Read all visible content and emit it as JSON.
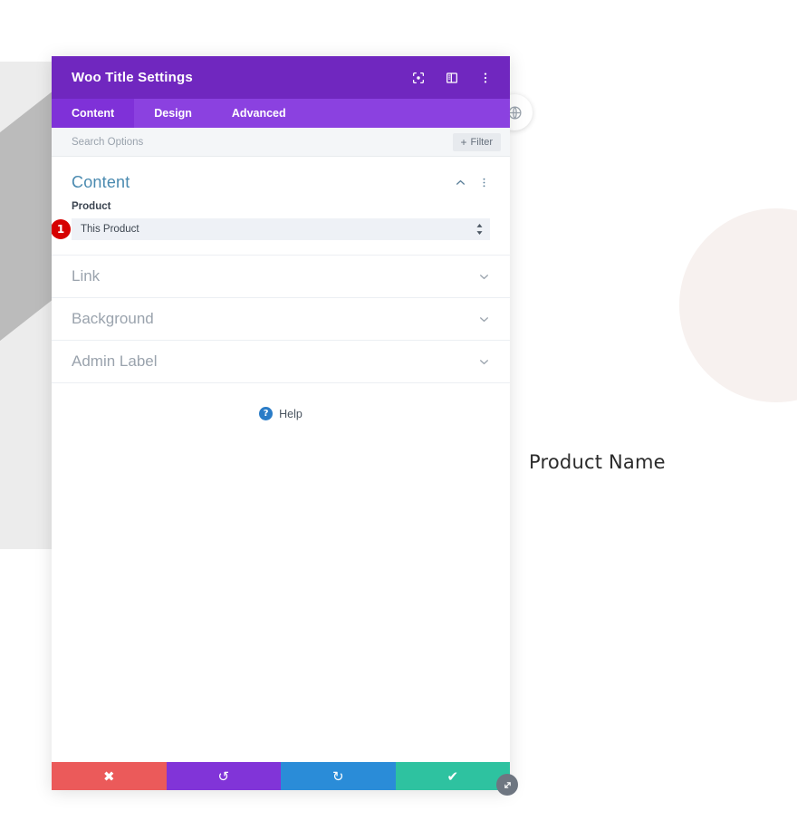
{
  "page": {
    "background_product_title": "Product Name",
    "floating_button_icon": "globe-icon"
  },
  "modal": {
    "title": "Woo Title Settings",
    "titlebar_icons": [
      {
        "name": "focus-target-icon",
        "label": "Focus"
      },
      {
        "name": "layout-panel-icon",
        "label": "Panel Layout"
      },
      {
        "name": "more-vertical-icon",
        "label": "More Options"
      }
    ],
    "tabs": [
      {
        "label": "Content",
        "active": true
      },
      {
        "label": "Design",
        "active": false
      },
      {
        "label": "Advanced",
        "active": false
      }
    ],
    "search": {
      "placeholder": "Search Options",
      "value": ""
    },
    "filter_button": {
      "label": "Filter",
      "plus": "+"
    },
    "open_section": {
      "title": "Content",
      "collapse_icon": "chevron-up-icon",
      "more_icon": "more-vertical-icon",
      "fields": [
        {
          "label": "Product",
          "type": "select",
          "value": "This Product",
          "step_badge": "1"
        }
      ]
    },
    "collapsed_sections": [
      {
        "title": "Link",
        "icon": "chevron-down-icon"
      },
      {
        "title": "Background",
        "icon": "chevron-down-icon"
      },
      {
        "title": "Admin Label",
        "icon": "chevron-down-icon"
      }
    ],
    "help": {
      "label": "Help",
      "icon": "question-mark-icon"
    },
    "footer_buttons": [
      {
        "name": "close-button",
        "icon": "x-icon",
        "glyph": "✖",
        "color": "#eb5a5a"
      },
      {
        "name": "undo-button",
        "icon": "undo-icon",
        "glyph": "↺",
        "color": "#8134d8"
      },
      {
        "name": "redo-button",
        "icon": "redo-icon",
        "glyph": "↻",
        "color": "#2a8cd8"
      },
      {
        "name": "save-button",
        "icon": "checkmark-icon",
        "glyph": "✔",
        "color": "#2ec2a0"
      }
    ],
    "resize_handle_icon": "diagonal-resize-icon"
  },
  "colors": {
    "titlebar": "#7027bf",
    "tabbar": "#8b41e0",
    "tab_active": "#7f31d8",
    "section_heading": "#4a8ab0",
    "badge_red": "#d60000",
    "help_blue": "#2a7cc7"
  }
}
